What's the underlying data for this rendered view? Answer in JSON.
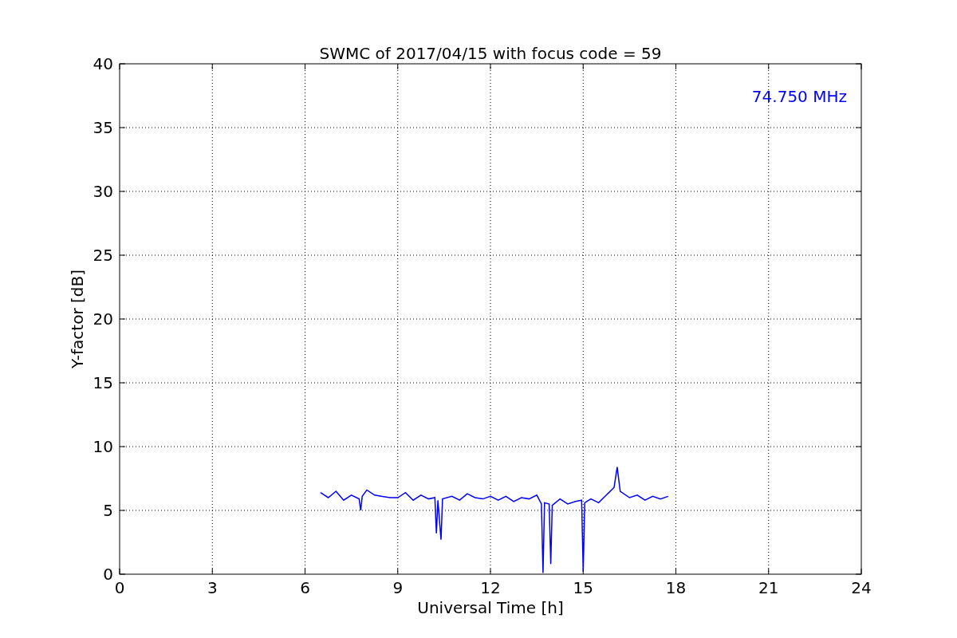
{
  "figure": {
    "chart_data": {
      "type": "line",
      "title": "SWMC of 2017/04/15 with focus code = 59",
      "xlabel": "Universal Time [h]",
      "ylabel": "Y-factor [dB]",
      "grid": true,
      "xlim": [
        0,
        24
      ],
      "ylim": [
        0,
        40
      ],
      "xticks": [
        0,
        3,
        6,
        9,
        12,
        15,
        18,
        21,
        24
      ],
      "yticks": [
        0,
        5,
        10,
        15,
        20,
        25,
        30,
        35,
        40
      ],
      "x": [
        6.5,
        6.75,
        7.0,
        7.25,
        7.5,
        7.75,
        7.8,
        7.85,
        8.0,
        8.25,
        8.5,
        8.75,
        9.0,
        9.25,
        9.5,
        9.75,
        10.0,
        10.2,
        10.25,
        10.3,
        10.4,
        10.45,
        10.75,
        11.0,
        11.25,
        11.5,
        11.75,
        12.0,
        12.25,
        12.5,
        12.75,
        13.0,
        13.25,
        13.5,
        13.65,
        13.7,
        13.75,
        13.9,
        13.95,
        14.0,
        14.25,
        14.5,
        14.75,
        14.95,
        15.0,
        15.05,
        15.25,
        15.5,
        15.75,
        16.0,
        16.1,
        16.2,
        16.5,
        16.75,
        17.0,
        17.25,
        17.5,
        17.75
      ],
      "series": [
        {
          "name": "74.750 MHz",
          "color": "#0000ff",
          "values": [
            6.4,
            6.0,
            6.5,
            5.8,
            6.2,
            5.9,
            5.0,
            6.1,
            6.6,
            6.2,
            6.1,
            6.0,
            6.0,
            6.4,
            5.8,
            6.2,
            5.9,
            6.0,
            3.2,
            5.8,
            2.7,
            5.9,
            6.1,
            5.8,
            6.3,
            6.0,
            5.9,
            6.1,
            5.8,
            6.1,
            5.7,
            6.0,
            5.9,
            6.2,
            5.5,
            0.1,
            5.6,
            5.5,
            0.8,
            5.4,
            5.9,
            5.5,
            5.7,
            5.8,
            0.2,
            5.6,
            5.9,
            5.6,
            6.2,
            6.8,
            8.4,
            6.5,
            6.0,
            6.2,
            5.8,
            6.1,
            5.9,
            6.1
          ]
        }
      ]
    }
  }
}
